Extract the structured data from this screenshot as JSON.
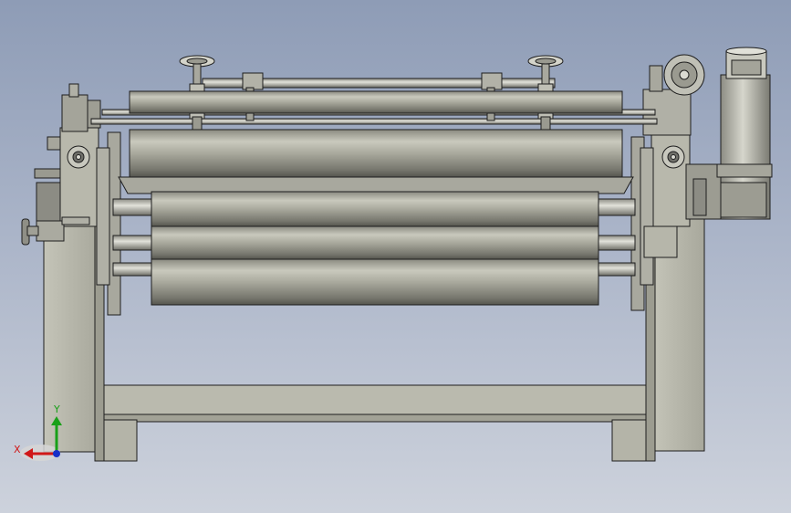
{
  "viewport": {
    "colors": {
      "background_top": "#8e9cb6",
      "background_bottom": "#cdd2dc",
      "part_fill": "#b9b9ac",
      "part_light": "#dcdcd2",
      "part_dark": "#6e6e66",
      "edge": "#1e1e1e"
    }
  },
  "triad": {
    "x_label": "X",
    "y_label": "Y",
    "x_color": "#d01818",
    "y_color": "#18a018",
    "z_color": "#1830c8"
  }
}
